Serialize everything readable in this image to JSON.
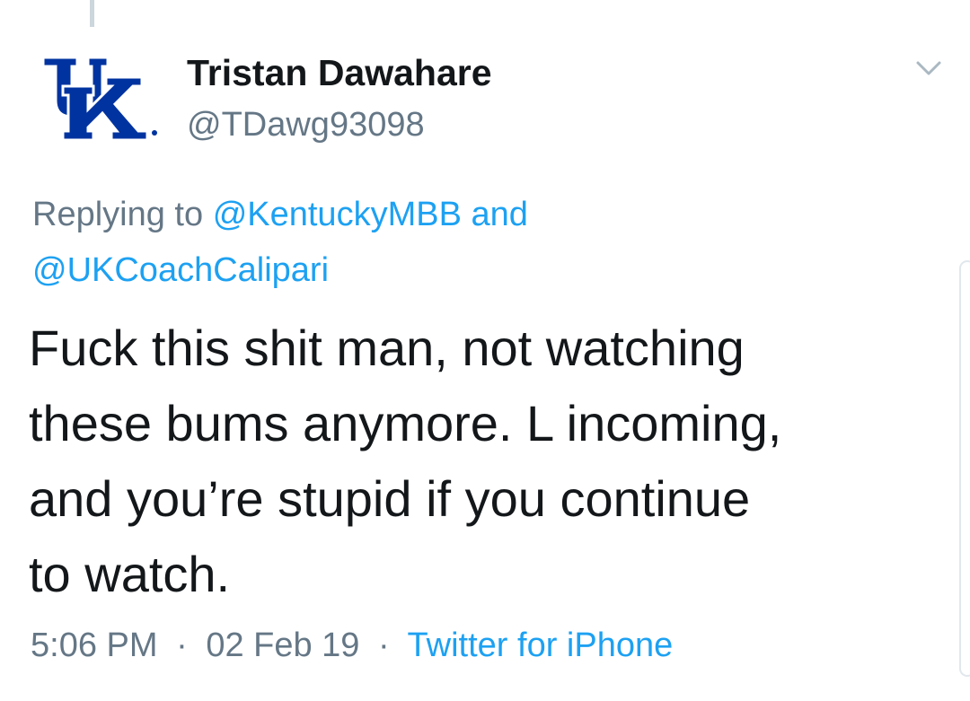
{
  "tweet": {
    "author": {
      "display_name": "Tristan Dawahare",
      "handle": "@TDawg93098",
      "avatar_icon": "kentucky-uk-logo-icon",
      "avatar_color": "#0033a0"
    },
    "reply": {
      "prefix": "Replying to",
      "mention_1": "@KentuckyMBB",
      "conjunction": "and",
      "mention_2": "@UKCoachCalipari"
    },
    "text_lines": [
      "Fuck this shit man, not watching",
      "these bums anymore. L incoming,",
      "and you’re stupid if you continue",
      "to watch."
    ],
    "meta": {
      "time": "5:06 PM",
      "separator": "·",
      "date": "02 Feb 19",
      "source": "Twitter for iPhone"
    },
    "menu_icon": "chevron-down-icon"
  },
  "colors": {
    "text_primary": "#14171a",
    "text_secondary": "#657786",
    "link": "#1da1f2",
    "thread_line": "#ccd6dd"
  }
}
